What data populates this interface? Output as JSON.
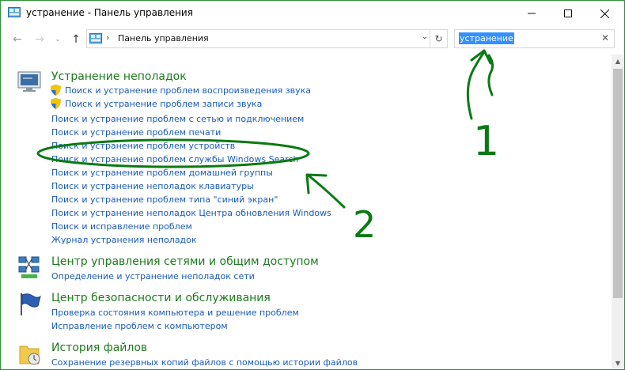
{
  "window": {
    "title": "устранение - Панель управления",
    "minimize_icon": "minimize-icon",
    "maximize_icon": "maximize-icon",
    "close_icon": "close-icon"
  },
  "nav": {
    "address": "Панель управления",
    "search_value": "устранение"
  },
  "sections": [
    {
      "title": "Устранение неполадок",
      "icon": "troubleshooting-icon",
      "links": [
        {
          "label": "Поиск и устранение проблем воспроизведения звука",
          "shield": true
        },
        {
          "label": "Поиск и устранение проблем записи звука",
          "shield": true
        },
        {
          "label": "Поиск и устранение проблем с сетью и подключением",
          "shield": false
        },
        {
          "label": "Поиск и устранение проблем печати",
          "shield": false
        },
        {
          "label": "Поиск и устранение проблем устройств",
          "shield": false
        },
        {
          "label": "Поиск и устранение проблем службы Windows Search",
          "shield": false
        },
        {
          "label": "Поиск и устранение проблем домашней группы",
          "shield": false
        },
        {
          "label": "Поиск и устранение неполадок клавиатуры",
          "shield": false
        },
        {
          "label": "Поиск и устранение проблем типа \"синий экран\"",
          "shield": false
        },
        {
          "label": "Поиск и устранение неполадок Центра обновления Windows",
          "shield": false
        },
        {
          "label": "Поиск и исправление проблем",
          "shield": false
        },
        {
          "label": "Журнал устранения неполадок",
          "shield": false
        }
      ]
    },
    {
      "title": "Центр управления сетями и общим доступом",
      "icon": "network-icon",
      "links": [
        {
          "label": "Определение и устранение неполадок сети",
          "shield": false
        }
      ]
    },
    {
      "title": "Центр безопасности и обслуживания",
      "icon": "flag-icon",
      "links": [
        {
          "label": "Проверка состояния компьютера и решение проблем",
          "shield": false
        },
        {
          "label": "Исправление проблем с компьютером",
          "shield": false
        }
      ]
    },
    {
      "title": "История файлов",
      "icon": "file-history-icon",
      "links": [
        {
          "label": "Сохранение резервных копий файлов с помощью истории файлов",
          "shield": false
        }
      ]
    }
  ],
  "annotations": {
    "marker_1": "1",
    "marker_2": "2",
    "color": "#0a7a12"
  }
}
